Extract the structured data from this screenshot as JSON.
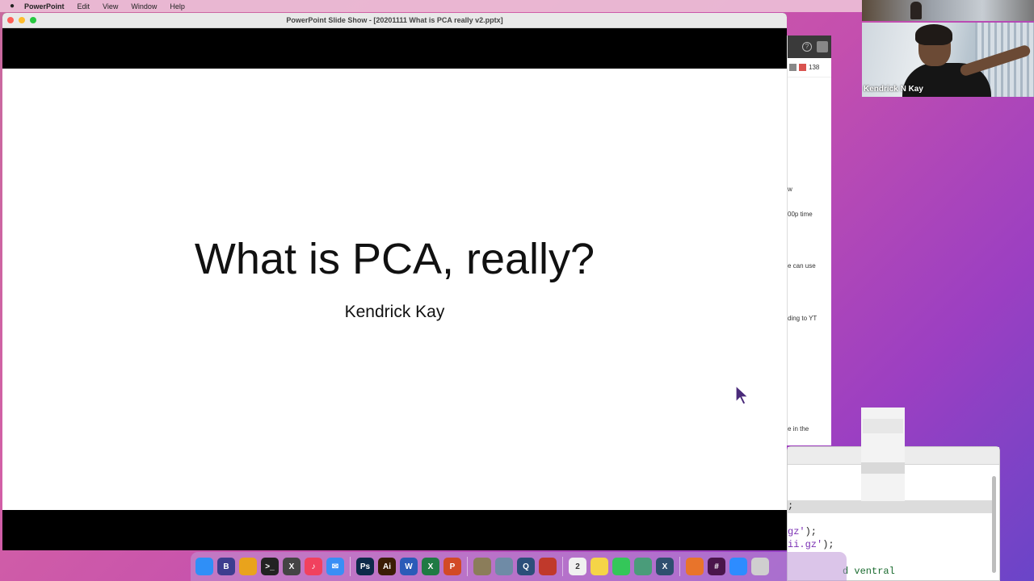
{
  "menubar": {
    "apple_icon": "apple-icon",
    "items": [
      "PowerPoint",
      "Edit",
      "View",
      "Window",
      "Help"
    ]
  },
  "ppt_window": {
    "title": "PowerPoint Slide Show - [20201111 What is PCA really v2.pptx]",
    "slide": {
      "title": "What is PCA, really?",
      "subtitle": "Kendrick Kay"
    }
  },
  "bg_window": {
    "help_icon": "help-icon",
    "count": "138",
    "snippets": [
      "w",
      "00p time",
      "e can use",
      "ding to YT",
      "e in the"
    ]
  },
  "editor": {
    "lines": [
      {
        "pre": "",
        "str": "",
        "post": ";",
        "kw": ""
      },
      {
        "pre": "",
        "str": "gz'",
        "post": ");",
        "kw": ""
      },
      {
        "pre": "",
        "str": "ii.gz'",
        "post": ");",
        "kw": ""
      },
      {
        "pre": "",
        "str": "",
        "post": "",
        "kw": "d ventral"
      }
    ]
  },
  "video": {
    "speaker_name": "Kendrick N Kay"
  },
  "dock": {
    "icons": [
      {
        "name": "finder-icon",
        "label": "",
        "color": "#2f8ff7"
      },
      {
        "name": "bbedit-icon",
        "label": "B",
        "color": "#3d3d8f"
      },
      {
        "name": "chrome-icon",
        "label": "",
        "color": "#e9a31c"
      },
      {
        "name": "terminal-icon",
        "label": ">_",
        "color": "#222222"
      },
      {
        "name": "x11-icon",
        "label": "X",
        "color": "#444444"
      },
      {
        "name": "music-icon",
        "label": "♪",
        "color": "#f1415e"
      },
      {
        "name": "mail-icon",
        "label": "✉",
        "color": "#3a8ef5"
      },
      {
        "name": "photoshop-icon",
        "label": "Ps",
        "color": "#0d2a4a"
      },
      {
        "name": "illustrator-icon",
        "label": "Ai",
        "color": "#3b1d05"
      },
      {
        "name": "word-icon",
        "label": "W",
        "color": "#2b5bb8"
      },
      {
        "name": "excel-icon",
        "label": "X",
        "color": "#1f7a44"
      },
      {
        "name": "powerpoint-icon",
        "label": "P",
        "color": "#d24a26"
      },
      {
        "name": "app-icon-1",
        "label": "",
        "color": "#8b7d5a"
      },
      {
        "name": "app-icon-2",
        "label": "",
        "color": "#6f8ba6"
      },
      {
        "name": "quicktime-icon",
        "label": "Q",
        "color": "#2c4f7a"
      },
      {
        "name": "app-icon-3",
        "label": "",
        "color": "#c0392b"
      },
      {
        "name": "calendar-icon",
        "label": "2",
        "color": "#f0f0f0"
      },
      {
        "name": "notes-icon",
        "label": "",
        "color": "#f5d547"
      },
      {
        "name": "messages-icon",
        "label": "",
        "color": "#34c759"
      },
      {
        "name": "app-icon-4",
        "label": "",
        "color": "#4a9c7a"
      },
      {
        "name": "xquartz-icon",
        "label": "X",
        "color": "#2f4f6f"
      },
      {
        "name": "matlab-icon",
        "label": "",
        "color": "#e8742b"
      },
      {
        "name": "slack-icon",
        "label": "#",
        "color": "#4a154b"
      },
      {
        "name": "zoom-icon",
        "label": "",
        "color": "#2d8cff"
      },
      {
        "name": "trash-icon",
        "label": "",
        "color": "#cfcfcf"
      }
    ]
  }
}
